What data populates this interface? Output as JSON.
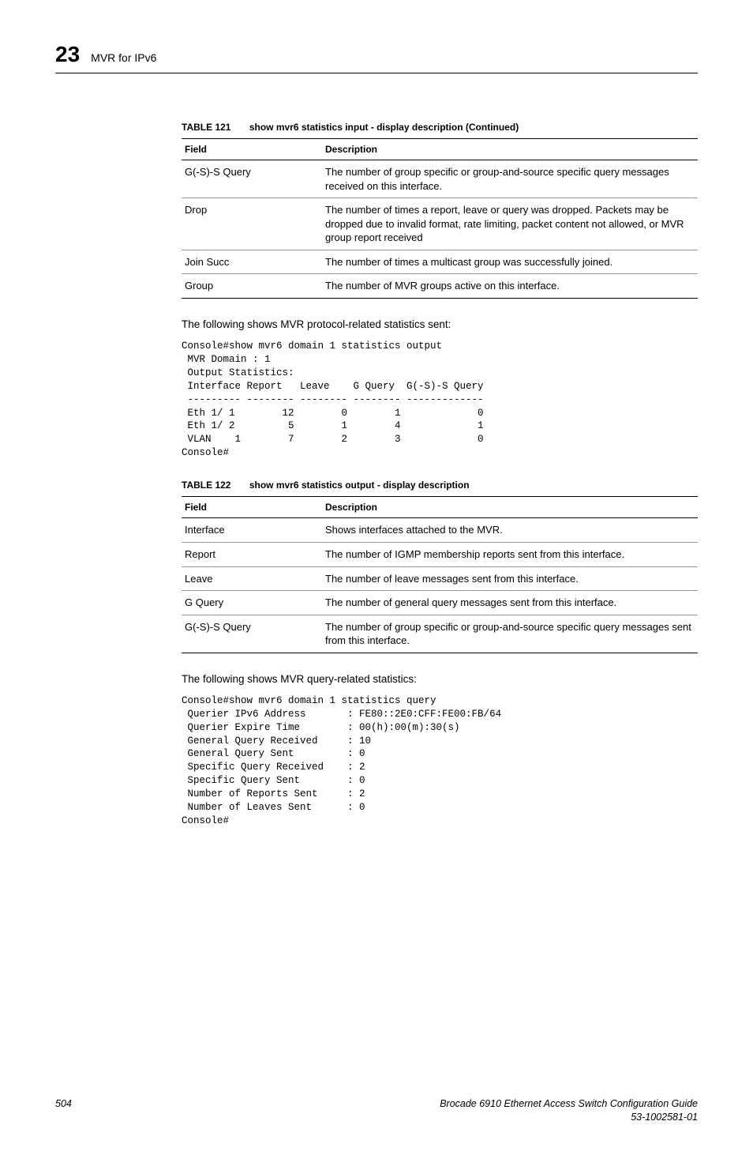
{
  "header": {
    "chapter_number": "23",
    "chapter_title": "MVR for IPv6"
  },
  "table121": {
    "label": "TABLE 121",
    "title": "show mvr6 statistics input - display description (Continued)",
    "head_field": "Field",
    "head_desc": "Description",
    "rows": [
      {
        "field": "G(-S)-S Query",
        "desc": "The number of group specific or group-and-source specific query messages received on this interface."
      },
      {
        "field": "Drop",
        "desc": "The number of times a report, leave or query was dropped. Packets may be dropped due to invalid format, rate limiting, packet content not allowed, or MVR group report received"
      },
      {
        "field": "Join Succ",
        "desc": "The number of times a multicast group was successfully joined."
      },
      {
        "field": "Group",
        "desc": "The number of MVR groups active on this interface."
      }
    ]
  },
  "para1": "The following shows MVR protocol-related statistics sent:",
  "console1": "Console#show mvr6 domain 1 statistics output\n MVR Domain : 1\n Output Statistics:\n Interface Report   Leave    G Query  G(-S)-S Query\n --------- -------- -------- -------- -------------\n Eth 1/ 1        12        0        1             0\n Eth 1/ 2         5        1        4             1\n VLAN    1        7        2        3             0\nConsole#",
  "table122": {
    "label": "TABLE 122",
    "title": "show mvr6 statistics output - display description",
    "head_field": "Field",
    "head_desc": "Description",
    "rows": [
      {
        "field": "Interface",
        "desc": "Shows interfaces attached to the MVR."
      },
      {
        "field": "Report",
        "desc": "The number of IGMP membership reports sent from this interface."
      },
      {
        "field": "Leave",
        "desc": "The number of leave messages sent from this interface."
      },
      {
        "field": "G Query",
        "desc": "The number of general query messages sent from this interface."
      },
      {
        "field": "G(-S)-S Query",
        "desc": "The number of group specific or group-and-source specific query messages sent from this interface."
      }
    ]
  },
  "para2": "The following shows MVR query-related statistics:",
  "console2": "Console#show mvr6 domain 1 statistics query\n Querier IPv6 Address       : FE80::2E0:CFF:FE00:FB/64\n Querier Expire Time        : 00(h):00(m):30(s)\n General Query Received     : 10\n General Query Sent         : 0\n Specific Query Received    : 2\n Specific Query Sent        : 0\n Number of Reports Sent     : 2\n Number of Leaves Sent      : 0\nConsole#",
  "footer": {
    "page": "504",
    "doc1": "Brocade 6910 Ethernet Access Switch Configuration Guide",
    "doc2": "53-1002581-01"
  }
}
